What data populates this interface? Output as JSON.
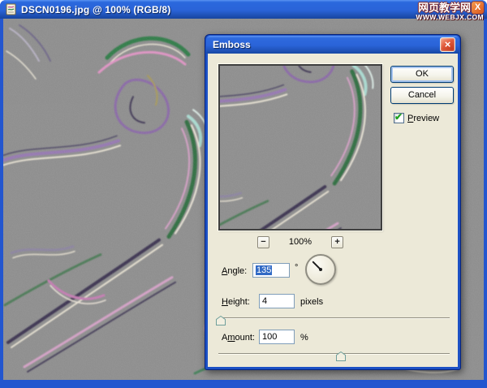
{
  "window": {
    "title": "DSCN0196.jpg @ 100% (RGB/8)"
  },
  "watermark": {
    "site_name": "网页教学网",
    "site_url": "www.webjx.com",
    "logo_letter": "X"
  },
  "dialog": {
    "title": "Emboss",
    "ok_label": "OK",
    "cancel_label": "Cancel",
    "close_glyph": "×",
    "preview": {
      "mnemonic": "P",
      "rest": "review",
      "checked": true,
      "check_glyph": "✔"
    },
    "zoom": {
      "minus_label": "−",
      "level": "100%",
      "plus_label": "+"
    },
    "angle": {
      "mnemonic": "A",
      "rest": "ngle:",
      "value": "135",
      "unit": "°"
    },
    "height": {
      "mnemonic": "H",
      "rest": "eight:",
      "value": "4",
      "unit": "pixels",
      "slider_pct": 1
    },
    "amount": {
      "prefix": "A",
      "mnemonic": "m",
      "rest": "ount:",
      "value": "100",
      "unit": "%",
      "slider_pct": 53
    }
  },
  "colors": {
    "titlebar_blue": "#2a63d8",
    "dialog_bg": "#ece9d8",
    "selection_blue": "#316ac5",
    "check_green": "#1fa11f",
    "close_red": "#d6492b",
    "canvas_gray": "#8e8e8e"
  }
}
